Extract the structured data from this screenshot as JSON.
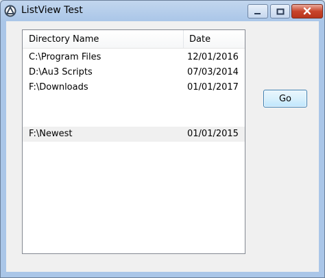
{
  "window": {
    "title": "ListView Test",
    "app_icon": "autoit-icon",
    "controls": [
      "minimize-icon",
      "maximize-icon",
      "close-icon"
    ]
  },
  "listview": {
    "columns": [
      "Directory Name",
      "Date"
    ],
    "rows": [
      {
        "name": "C:\\Program Files",
        "date": "12/01/2016",
        "selected": false
      },
      {
        "name": "D:\\Au3 Scripts",
        "date": "07/03/2014",
        "selected": false
      },
      {
        "name": "F:\\Downloads",
        "date": "01/01/2017",
        "selected": false
      },
      {
        "name": "",
        "date": "",
        "selected": false
      },
      {
        "name": "",
        "date": "",
        "selected": false
      },
      {
        "name": "F:\\Newest",
        "date": "01/01/2015",
        "selected": true
      }
    ]
  },
  "go_button": {
    "label": "Go"
  },
  "colors": {
    "selection": "#f0f0f0",
    "close_button": "#c8442b",
    "button_border": "#3c7fb1"
  }
}
